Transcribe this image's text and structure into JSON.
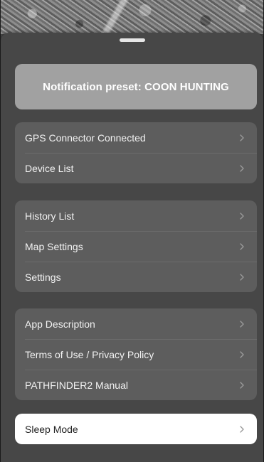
{
  "preset": {
    "label": "Notification preset: COON HUNTING"
  },
  "groups": [
    {
      "items": [
        {
          "label": "GPS Connector Connected",
          "icon": "chevron-right-icon"
        },
        {
          "label": "Device List",
          "icon": "chevron-right-icon"
        }
      ]
    },
    {
      "items": [
        {
          "label": "History List",
          "icon": "chevron-right-icon"
        },
        {
          "label": "Map Settings",
          "icon": "chevron-right-icon"
        },
        {
          "label": "Settings",
          "icon": "chevron-right-icon"
        }
      ]
    },
    {
      "items": [
        {
          "label": "App Description",
          "icon": "chevron-right-icon"
        },
        {
          "label": "Terms of Use / Privacy Policy",
          "icon": "chevron-right-icon"
        },
        {
          "label": "PATHFINDER2 Manual",
          "icon": "chevron-right-icon"
        }
      ]
    }
  ],
  "sleep_mode": {
    "label": "Sleep Mode",
    "icon": "chevron-right-icon"
  },
  "colors": {
    "sheet_background": "#474747",
    "group_background": "#5d5d5d",
    "preset_background": "#a1a1a1",
    "sleep_background": "#ffffff"
  }
}
